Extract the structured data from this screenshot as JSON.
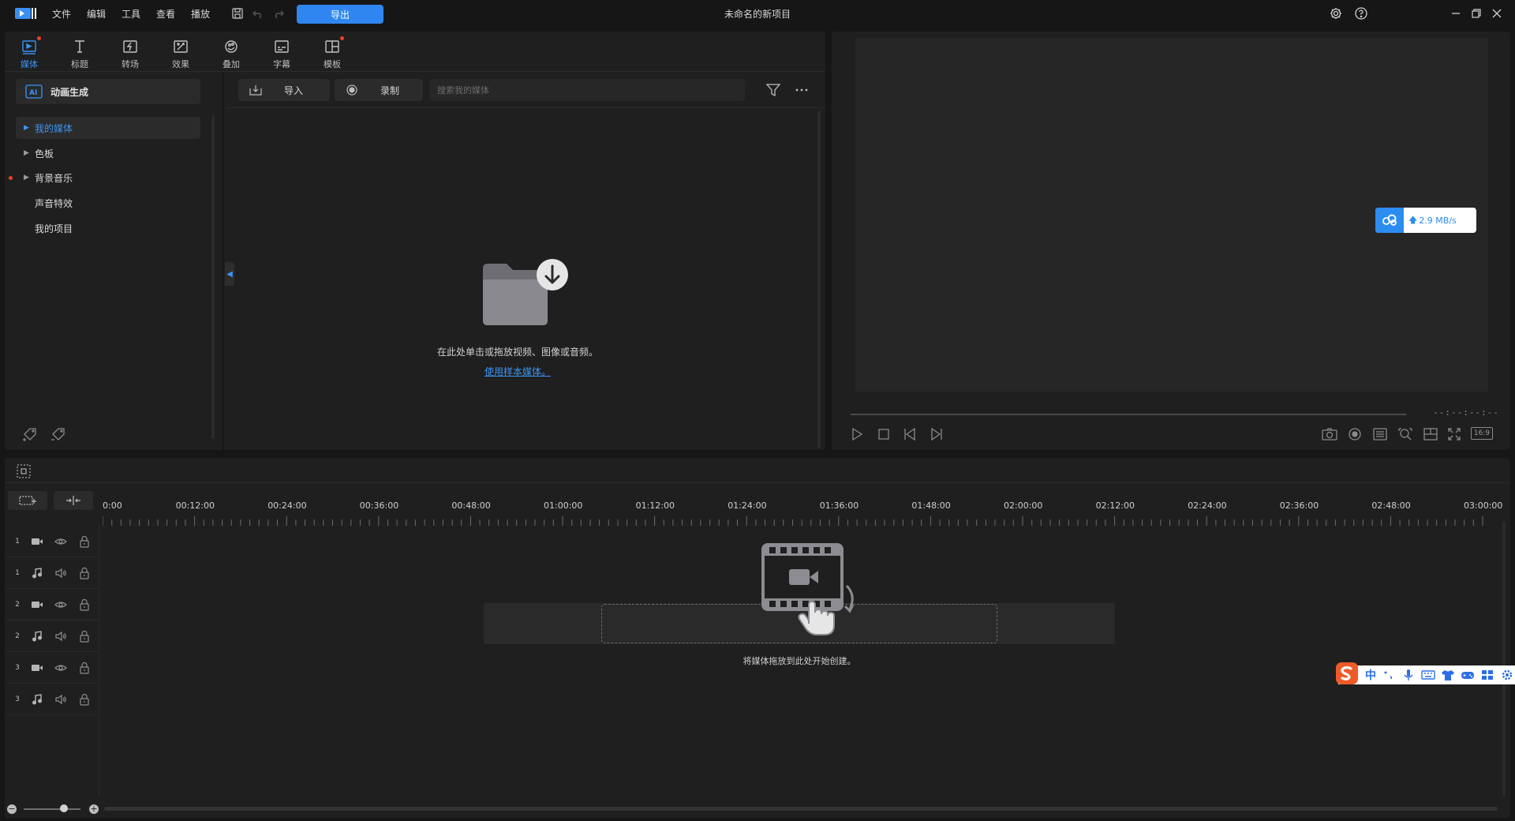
{
  "menu": [
    "文件",
    "编辑",
    "工具",
    "查看",
    "播放"
  ],
  "export_label": "导出",
  "project_title": "未命名的新项目",
  "categories": [
    {
      "label": "媒体",
      "icon": "media-icon",
      "active": true,
      "dot": true
    },
    {
      "label": "标题",
      "icon": "title-icon",
      "active": false,
      "dot": false
    },
    {
      "label": "转场",
      "icon": "transition-icon",
      "active": false,
      "dot": false
    },
    {
      "label": "效果",
      "icon": "effects-icon",
      "active": false,
      "dot": false
    },
    {
      "label": "叠加",
      "icon": "overlay-icon",
      "active": false,
      "dot": false
    },
    {
      "label": "字幕",
      "icon": "subtitle-icon",
      "active": false,
      "dot": false
    },
    {
      "label": "模板",
      "icon": "template-icon",
      "active": false,
      "dot": true
    }
  ],
  "sidebar": {
    "ai_label": "动画生成",
    "items": [
      {
        "label": "我的媒体",
        "expandable": true,
        "selected": true
      },
      {
        "label": "色板",
        "expandable": true,
        "selected": false
      },
      {
        "label": "背景音乐",
        "expandable": true,
        "selected": false
      },
      {
        "label": "声音特效",
        "expandable": false,
        "selected": false
      },
      {
        "label": "我的项目",
        "expandable": false,
        "selected": false
      }
    ]
  },
  "media": {
    "import_label": "导入",
    "record_label": "录制",
    "search_placeholder": "搜索我的媒体",
    "empty_text": "在此处单击或拖放视频、图像或音频。",
    "sample_link": "使用样本媒体。"
  },
  "preview": {
    "speed": "2.9 MB/s",
    "timecode": "--:--:--:--",
    "aspect": "16:9"
  },
  "timeline": {
    "ruler": [
      "0:00",
      "00:12:00",
      "00:24:00",
      "00:36:00",
      "00:48:00",
      "01:00:00",
      "01:12:00",
      "01:24:00",
      "01:36:00",
      "01:48:00",
      "02:00:00",
      "02:12:00",
      "02:24:00",
      "02:36:00",
      "02:48:00",
      "03:00:00"
    ],
    "tracks": [
      {
        "num": "1",
        "type": "video"
      },
      {
        "num": "1",
        "type": "audio"
      },
      {
        "num": "2",
        "type": "video"
      },
      {
        "num": "2",
        "type": "audio"
      },
      {
        "num": "3",
        "type": "video"
      },
      {
        "num": "3",
        "type": "audio"
      }
    ],
    "drop_text": "将媒体拖放到此处开始创建。"
  },
  "ime": {
    "lang": "中"
  },
  "colors": {
    "accent": "#2f86f0",
    "background": "#161616",
    "panel": "#1f1f1f",
    "notify_dot": "#e8412c"
  }
}
